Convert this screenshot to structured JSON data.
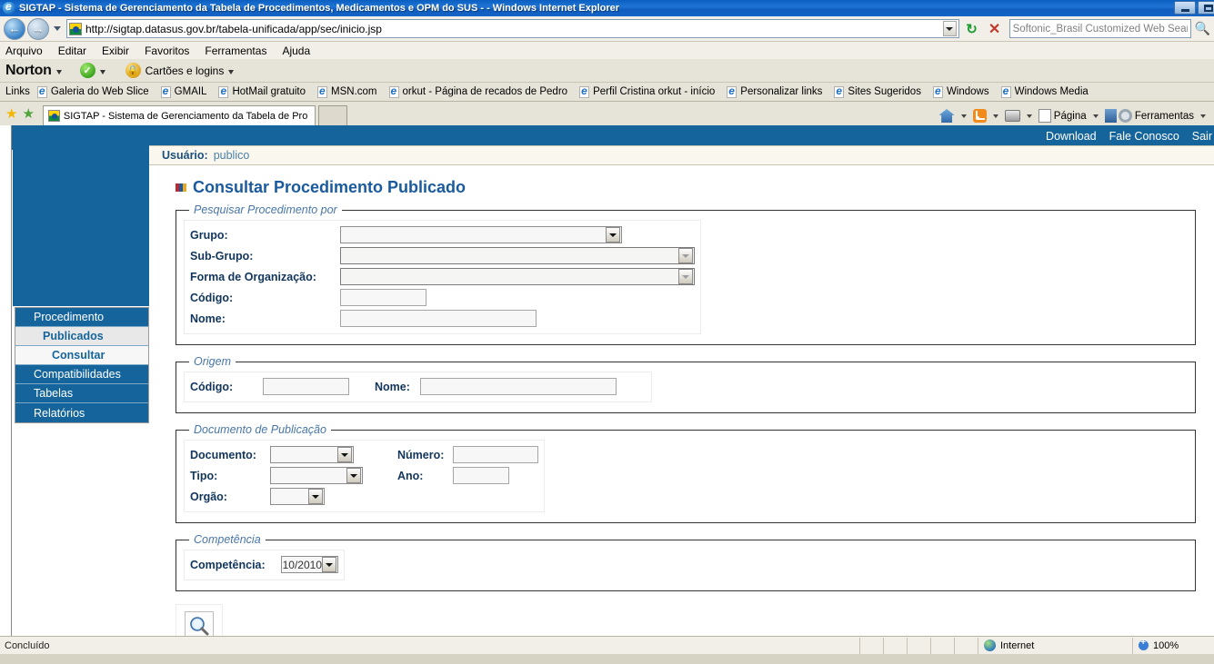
{
  "window": {
    "title": "SIGTAP - Sistema de Gerenciamento da Tabela de Procedimentos, Medicamentos e OPM do SUS - - Windows Internet Explorer",
    "minimize_label": "Minimizar",
    "maximize_label": "Maximizar"
  },
  "address_bar": {
    "url": "http://sigtap.datasus.gov.br/tabela-unificada/app/sec/inicio.jsp",
    "back_icon": "back-arrow-icon",
    "forward_icon": "forward-arrow-icon",
    "refresh_icon": "refresh-icon",
    "stop_icon": "stop-icon",
    "search_placeholder": "Softonic_Brasil Customized Web Search",
    "search_icon": "search-icon"
  },
  "menu_bar": {
    "items": [
      {
        "label": "Arquivo"
      },
      {
        "label": "Editar"
      },
      {
        "label": "Exibir"
      },
      {
        "label": "Favoritos"
      },
      {
        "label": "Ferramentas"
      },
      {
        "label": "Ajuda"
      }
    ]
  },
  "norton_bar": {
    "brand": "Norton",
    "safe_icon": "green-check-icon",
    "lock_icon": "lock-icon",
    "cards_label": "Cartões e logins"
  },
  "links_bar": {
    "title": "Links",
    "items": [
      {
        "label": "Galeria do Web Slice"
      },
      {
        "label": "GMAIL"
      },
      {
        "label": "HotMail gratuito"
      },
      {
        "label": "MSN.com"
      },
      {
        "label": "orkut - Página de recados de Pedro"
      },
      {
        "label": "Perfil Cristina orkut - início"
      },
      {
        "label": "Personalizar links"
      },
      {
        "label": "Sites Sugeridos"
      },
      {
        "label": "Windows"
      },
      {
        "label": "Windows Media"
      }
    ]
  },
  "tab_bar": {
    "favorites_icon": "star-icon",
    "add_favorite_icon": "add-star-icon",
    "active_tab": "SIGTAP - Sistema de Gerenciamento da Tabela de Pro...",
    "new_tab_label": "",
    "right_tools": [
      {
        "icon": "home-icon",
        "label": ""
      },
      {
        "icon": "rss-icon",
        "label": ""
      },
      {
        "icon": "print-icon",
        "label": ""
      },
      {
        "icon": "page-icon",
        "label": "Página"
      },
      {
        "icon": "safety-icon",
        "label": ""
      },
      {
        "icon": "gear-icon",
        "label": "Ferramentas"
      }
    ]
  },
  "top_links": {
    "items": [
      {
        "label": "Download"
      },
      {
        "label": "Fale Conosco"
      },
      {
        "label": "Sair"
      }
    ]
  },
  "sidebar": {
    "items": [
      {
        "label": "Procedimento",
        "level": 0
      },
      {
        "label": "Publicados",
        "level": 1
      },
      {
        "label": "Consultar",
        "level": 2
      },
      {
        "label": "Compatibilidades",
        "level": 0
      },
      {
        "label": "Tabelas",
        "level": 0
      },
      {
        "label": "Relatórios",
        "level": 0
      }
    ]
  },
  "user_bar": {
    "label": "Usuário:",
    "value": "publico"
  },
  "page": {
    "title": "Consultar Procedimento Publicado"
  },
  "search_section": {
    "legend": "Pesquisar Procedimento por",
    "fields": {
      "grupo_label": "Grupo:",
      "grupo_value": "",
      "subgrupo_label": "Sub-Grupo:",
      "subgrupo_value": "",
      "forma_label": "Forma de Organização:",
      "forma_value": "",
      "codigo_label": "Código:",
      "codigo_value": "",
      "nome_label": "Nome:",
      "nome_value": ""
    }
  },
  "origem_section": {
    "legend": "Origem",
    "fields": {
      "codigo_label": "Código:",
      "codigo_value": "",
      "nome_label": "Nome:",
      "nome_value": ""
    }
  },
  "documento_section": {
    "legend": "Documento de Publicação",
    "fields": {
      "documento_label": "Documento:",
      "documento_value": "",
      "numero_label": "Número:",
      "numero_value": "",
      "tipo_label": "Tipo:",
      "tipo_value": "",
      "ano_label": "Ano:",
      "ano_value": "",
      "orgao_label": "Orgão:",
      "orgao_value": ""
    }
  },
  "competencia_section": {
    "legend": "Competência",
    "fields": {
      "competencia_label": "Competência:",
      "competencia_value": "10/2010"
    }
  },
  "actions": {
    "search_icon": "magnifier-icon",
    "search_title": "Pesquisar"
  },
  "status_bar": {
    "text": "Concluído",
    "zone": "Internet",
    "zone_icon": "globe-icon",
    "zoom": "100%",
    "zoom_icon": "zoom-icon"
  },
  "colors": {
    "brand_blue": "#15659c",
    "title_blue": "#1a5a9e",
    "legend_blue": "#4876a8",
    "label_navy": "#12355c"
  }
}
